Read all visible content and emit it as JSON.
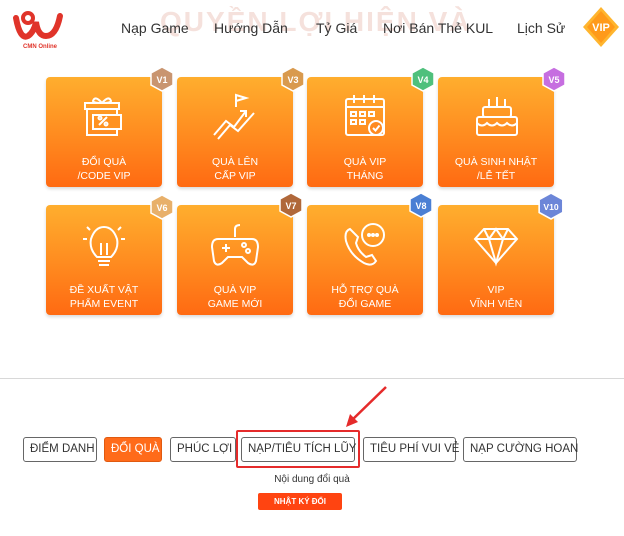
{
  "header": {
    "logo_text": "CMN Online",
    "watermark": "QUYỀN LỢI HIỆN VÀ",
    "nav": [
      "Nạp Game",
      "Hướng Dẫn",
      "Tỷ Giá",
      "Nơi Bán Thẻ KUL",
      "Lịch Sử"
    ],
    "vip_label": "VIP"
  },
  "cards": [
    {
      "label": "ĐỔI QUÀ\n/CODE VIP",
      "level": "V1",
      "icon": "gift-voucher-icon"
    },
    {
      "label": "QUÀ LÊN\nCẤP VIP",
      "level": "V3",
      "icon": "level-up-chart-icon"
    },
    {
      "label": "QUÀ VIP\nTHÁNG",
      "level": "V4",
      "icon": "calendar-icon"
    },
    {
      "label": "QUÀ SINH NHẬT\n/LỄ TẾT",
      "level": "V5",
      "icon": "birthday-cake-icon"
    },
    {
      "label": "ĐỀ XUẤT VẬT\nPHẨM EVENT",
      "level": "V6",
      "icon": "lightbulb-icon"
    },
    {
      "label": "QUÀ VIP\nGAME MỚI",
      "level": "V7",
      "icon": "gamepad-icon"
    },
    {
      "label": "HỖ TRỢ QUÀ\nĐỔI GAME",
      "level": "V8",
      "icon": "support-call-icon"
    },
    {
      "label": "VIP\nVĨNH VIỄN",
      "level": "V10",
      "icon": "diamond-icon"
    }
  ],
  "tabs": [
    "ĐIỂM DANH",
    "ĐỔI QUÀ",
    "PHÚC LỢI",
    "NẠP/TIÊU TÍCH LŨY",
    "TIÊU PHÍ VUI VẺ",
    "NẠP CƯỜNG HOAN"
  ],
  "active_tab": "ĐỔI QUÀ",
  "content_text": "Nội dung đổi quà",
  "history_button": "NHẬT KÝ ĐỔI",
  "colors": {
    "brand": "#e0342a",
    "accent": "#ff6b1a",
    "highlight": "#e52b2b"
  }
}
